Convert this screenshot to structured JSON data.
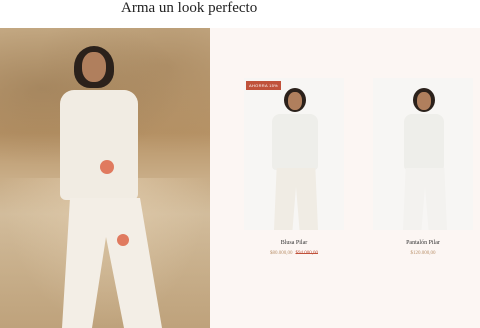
{
  "page": {
    "title": "Arma un look perfecto"
  },
  "colors": {
    "badge": "#c0523b",
    "price": "#b9916b",
    "panel_bg": "#fcf6f3"
  },
  "hero": {
    "image": "hero-photo"
  },
  "products": [
    {
      "name": "Blusa Pilar",
      "badge": "AHORRA 15%",
      "price": "$80.000,00",
      "old_price": "$94.000,00"
    },
    {
      "name": "Pantalón Pilar",
      "price": "$120.000,00"
    }
  ]
}
